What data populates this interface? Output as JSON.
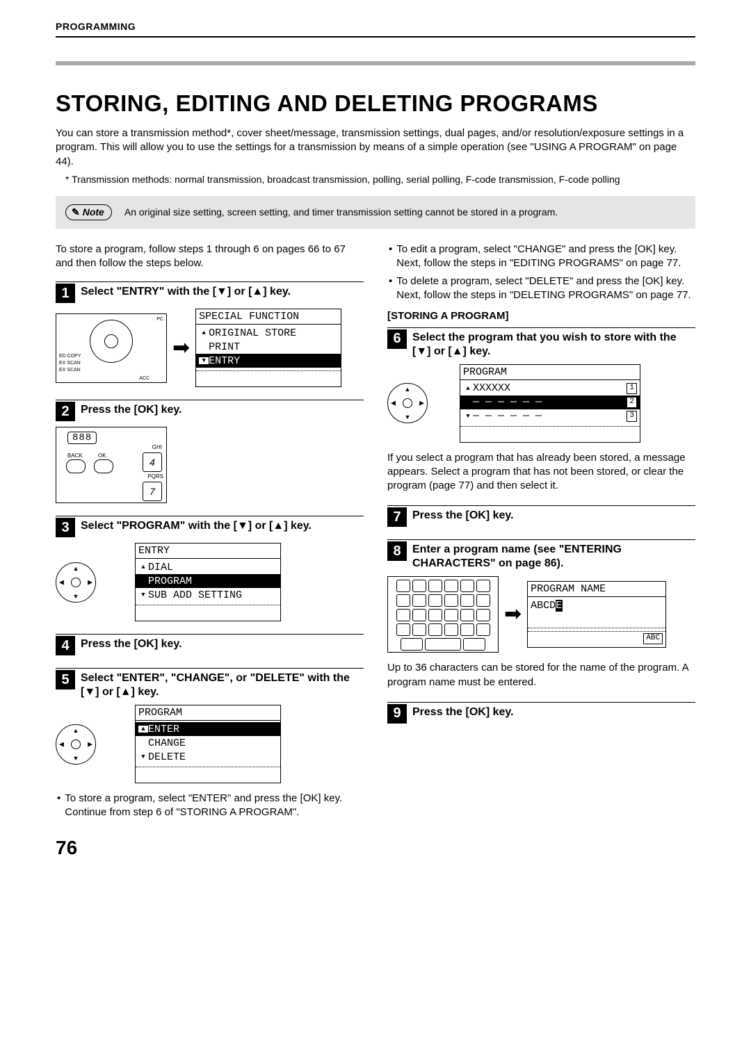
{
  "header_label": "PROGRAMMING",
  "main_title": "STORING, EDITING AND DELETING PROGRAMS",
  "intro_text": "You can store a transmission method*, cover sheet/message, transmission settings, dual pages, and/or resolution/exposure settings in a program. This will allow you to use the settings for a transmission by means of a simple operation (see \"USING A PROGRAM\" on page 44).",
  "footnote": "* Transmission methods: normal transmission, broadcast transmission, polling, serial polling, F-code transmission, F-code polling",
  "note_label": "Note",
  "note_text": "An original size setting, screen setting, and timer transmission setting cannot be stored in a program.",
  "pre_text": "To store a program, follow steps 1 through 6 on pages 66 to 67 and then follow the steps below.",
  "steps_left": {
    "s1": {
      "num": "1",
      "title": "Select \"ENTRY\" with the [▼] or [▲] key."
    },
    "s2": {
      "num": "2",
      "title": "Press the [OK] key."
    },
    "s3": {
      "num": "3",
      "title": "Select \"PROGRAM\" with the [▼] or [▲] key."
    },
    "s4": {
      "num": "4",
      "title": "Press the [OK] key."
    },
    "s5": {
      "num": "5",
      "title": "Select \"ENTER\", \"CHANGE\", or \"DELETE\" with the [▼] or [▲] key."
    }
  },
  "bullets_right_top": [
    "To edit a program, select \"CHANGE\" and press the [OK] key. Next, follow the steps in \"EDITING PROGRAMS\" on page 77.",
    "To delete a program, select \"DELETE\" and press the [OK] key. Next, follow the steps in \"DELETING PROGRAMS\" on page 77."
  ],
  "storing_heading": "[STORING A PROGRAM]",
  "steps_right": {
    "s6": {
      "num": "6",
      "title": "Select the program that you wish to store with the [▼] or [▲] key."
    },
    "s7": {
      "num": "7",
      "title": "Press the [OK] key."
    },
    "s8": {
      "num": "8",
      "title": "Enter a program name (see \"ENTERING CHARACTERS\" on page 86)."
    },
    "s9": {
      "num": "9",
      "title": "Press the [OK] key."
    }
  },
  "bullet_left_bottom": "To store a program, select \"ENTER\" and press the [OK] key. Continue from step 6 of \"STORING A PROGRAM\".",
  "post_s6": "If you select a program that has already been stored, a message appears. Select a program that has not been stored, or clear the program (page 77) and then select it.",
  "post_s8": "Up to 36 characters can be stored for the name of the program. A program name must be entered.",
  "screens": {
    "special_function": {
      "title": "SPECIAL FUNCTION",
      "line1": "ORIGINAL STORE",
      "line2": "PRINT",
      "line3": "ENTRY"
    },
    "entry_menu": {
      "title": "ENTRY",
      "line1": "DIAL",
      "line2": "PROGRAM",
      "line3": "SUB ADD SETTING"
    },
    "program_action": {
      "title": "PROGRAM",
      "line1": "ENTER",
      "line2": "CHANGE",
      "line3": "DELETE"
    },
    "program_list": {
      "title": "PROGRAM",
      "line1": "XXXXXX",
      "line2": "— — — — — —",
      "line3": "— — — — — —"
    },
    "program_name": {
      "title": "PROGRAM NAME",
      "value": "ABCD",
      "mode": "ABC"
    }
  },
  "panel_labels": {
    "ed_copy": "ED COPY",
    "ex_scan": "EX SCAN",
    "ex_scan2": "EX SCAN",
    "acc": "ACC",
    "pc": "PC",
    "back": "BACK",
    "ok": "OK",
    "ghi": "GHI",
    "pqrs": "PQRS",
    "lcd": "888",
    "key4": "4",
    "key7": "7"
  },
  "page_number": "76"
}
